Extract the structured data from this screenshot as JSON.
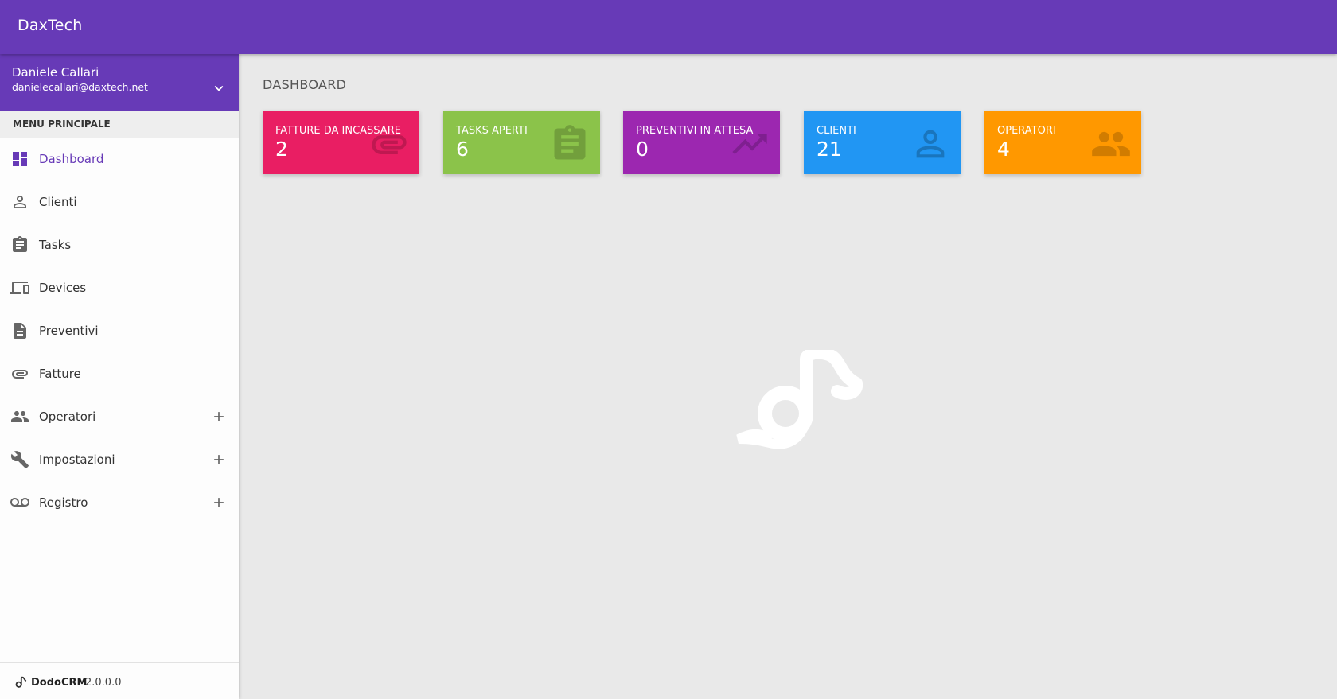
{
  "app": {
    "brand": "DaxTech"
  },
  "user": {
    "name": "Daniele Callari",
    "email": "danielecallari@daxtech.net"
  },
  "sidebar": {
    "section_header": "MENU PRINCIPALE",
    "items": [
      {
        "label": "Dashboard",
        "icon": "dashboard-icon",
        "active": true
      },
      {
        "label": "Clienti",
        "icon": "person-icon"
      },
      {
        "label": "Tasks",
        "icon": "assignment-icon"
      },
      {
        "label": "Devices",
        "icon": "devices-icon"
      },
      {
        "label": "Preventivi",
        "icon": "description-icon"
      },
      {
        "label": "Fatture",
        "icon": "attachment-icon"
      },
      {
        "label": "Operatori",
        "icon": "people-icon",
        "expandable": true
      },
      {
        "label": "Impostazioni",
        "icon": "wrench-icon",
        "expandable": true
      },
      {
        "label": "Registro",
        "icon": "voicemail-icon",
        "expandable": true
      }
    ],
    "footer": {
      "name": "DodoCRM",
      "version": "2.0.0.0"
    }
  },
  "main": {
    "title": "DASHBOARD",
    "cards": [
      {
        "label": "FATTURE DA INCASSARE",
        "value": "2",
        "color": "#e91e63",
        "icon": "attachment-icon"
      },
      {
        "label": "TASKS APERTI",
        "value": "6",
        "color": "#8bc34a",
        "icon": "assignment-icon"
      },
      {
        "label": "PREVENTIVI IN ATTESA",
        "value": "0",
        "color": "#9c27b0",
        "icon": "trending-up-icon"
      },
      {
        "label": "CLIENTI",
        "value": "21",
        "color": "#2196f3",
        "icon": "person-icon"
      },
      {
        "label": "OPERATORI",
        "value": "4",
        "color": "#ff9800",
        "icon": "people-icon"
      }
    ]
  },
  "colors": {
    "primary": "#673ab7",
    "background": "#e9e9e9"
  }
}
